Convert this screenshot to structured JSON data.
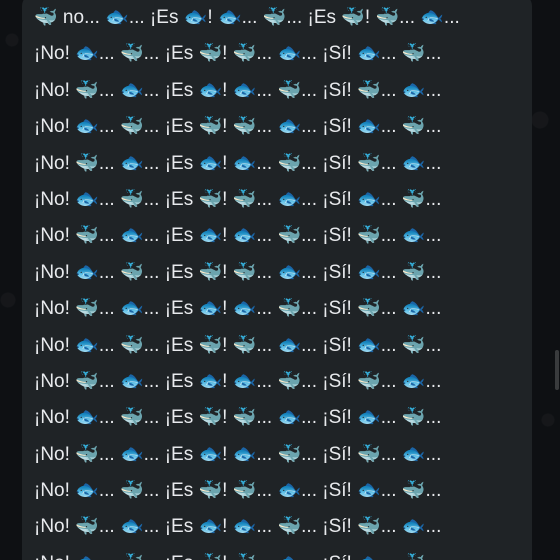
{
  "chat": {
    "message": {
      "lines": [
        "🐳 no... 🐟... ¡Es 🐟! 🐟... 🐳... ¡Es 🐳! 🐳... 🐟...",
        "¡No! 🐟... 🐳... ¡Es 🐳! 🐳... 🐟... ¡Sí! 🐟... 🐳...",
        "¡No! 🐳... 🐟... ¡Es 🐟! 🐟... 🐳... ¡Sí! 🐳... 🐟...",
        "¡No! 🐟... 🐳... ¡Es 🐳! 🐳... 🐟... ¡Sí! 🐟... 🐳...",
        "¡No! 🐳... 🐟... ¡Es 🐟! 🐟... 🐳... ¡Sí! 🐳... 🐟...",
        "¡No! 🐟... 🐳... ¡Es 🐳! 🐳... 🐟... ¡Sí! 🐟... 🐳...",
        "¡No! 🐳... 🐟... ¡Es 🐟! 🐟... 🐳... ¡Sí! 🐳... 🐟...",
        "¡No! 🐟... 🐳... ¡Es 🐳! 🐳... 🐟... ¡Sí! 🐟... 🐳...",
        "¡No! 🐳... 🐟... ¡Es 🐟! 🐟... 🐳... ¡Sí! 🐳... 🐟...",
        "¡No! 🐟... 🐳... ¡Es 🐳! 🐳... 🐟... ¡Sí! 🐟... 🐳...",
        "¡No! 🐳... 🐟... ¡Es 🐟! 🐟... 🐳... ¡Sí! 🐳... 🐟...",
        "¡No! 🐟... 🐳... ¡Es 🐳! 🐳... 🐟... ¡Sí! 🐟... 🐳...",
        "¡No! 🐳... 🐟... ¡Es 🐟! 🐟... 🐳... ¡Sí! 🐳... 🐟...",
        "¡No! 🐟... 🐳... ¡Es 🐳! 🐳... 🐟... ¡Sí! 🐟... 🐳...",
        "¡No! 🐳... 🐟... ¡Es 🐟! 🐟... 🐳... ¡Sí! 🐳... 🐟...",
        "¡No! 🐟... 🐳... ¡Es 🐳! 🐳... 🐟... ¡Sí! 🐟... 🐳..."
      ],
      "icons": [
        "whale-icon",
        "fish-icon"
      ]
    }
  },
  "theme": {
    "background": "#0e1013",
    "bubble": "#1f2326",
    "text": "#e8eaed"
  }
}
